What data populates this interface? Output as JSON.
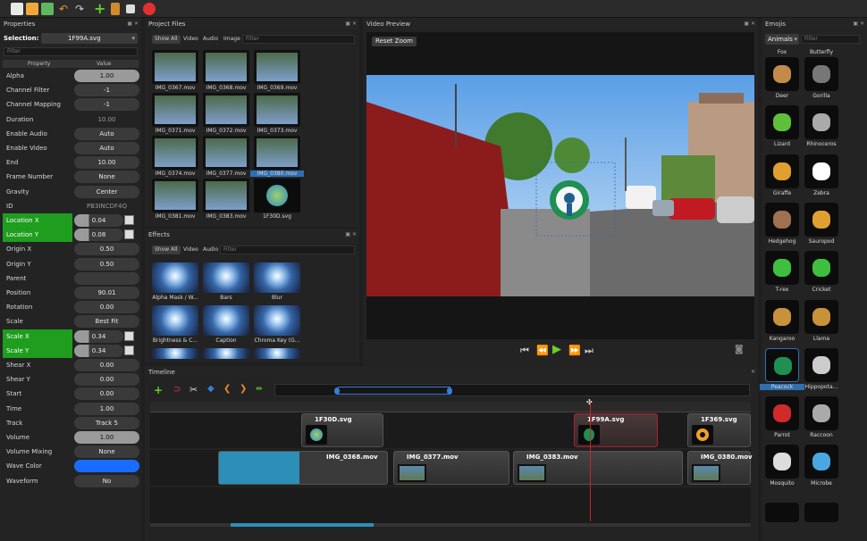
{
  "colors": {
    "accent_green": "#1e9d1e",
    "wave_color": "#1a6cff",
    "selection": "#2f6fb0",
    "playhead": "#d0202a"
  },
  "toolbar": {
    "icons": [
      "new-project-icon",
      "open-project-icon",
      "save-project-icon",
      "undo-icon",
      "redo-icon",
      "import-files-icon",
      "choose-profile-icon",
      "fullscreen-icon",
      "export-video-icon"
    ]
  },
  "properties": {
    "title": "Properties",
    "selection_label": "Selection:",
    "selection_value": "1F99A.svg",
    "filter_placeholder": "Filter",
    "col_property": "Property",
    "col_value": "Value",
    "rows": [
      {
        "name": "Alpha",
        "value": "1.00"
      },
      {
        "name": "Channel Filter",
        "value": "-1"
      },
      {
        "name": "Channel Mapping",
        "value": "-1"
      },
      {
        "name": "Duration",
        "value": "10.00"
      },
      {
        "name": "Enable Audio",
        "value": "Auto"
      },
      {
        "name": "Enable Video",
        "value": "Auto"
      },
      {
        "name": "End",
        "value": "10.00"
      },
      {
        "name": "Frame Number",
        "value": "None"
      },
      {
        "name": "Gravity",
        "value": "Center"
      },
      {
        "name": "ID",
        "value": "PB3INCDF4Q"
      },
      {
        "name": "Location X",
        "value": "0.04"
      },
      {
        "name": "Location Y",
        "value": "0.08"
      },
      {
        "name": "Origin X",
        "value": "0.50"
      },
      {
        "name": "Origin Y",
        "value": "0.50"
      },
      {
        "name": "Parent",
        "value": ""
      },
      {
        "name": "Position",
        "value": "90.01"
      },
      {
        "name": "Rotation",
        "value": "0.00"
      },
      {
        "name": "Scale",
        "value": "Best Fit"
      },
      {
        "name": "Scale X",
        "value": "0.34"
      },
      {
        "name": "Scale Y",
        "value": "0.34"
      },
      {
        "name": "Shear X",
        "value": "0.00"
      },
      {
        "name": "Shear Y",
        "value": "0.00"
      },
      {
        "name": "Start",
        "value": "0.00"
      },
      {
        "name": "Time",
        "value": "1.00"
      },
      {
        "name": "Track",
        "value": "Track 5"
      },
      {
        "name": "Volume",
        "value": "1.00"
      },
      {
        "name": "Volume Mixing",
        "value": "None"
      },
      {
        "name": "Wave Color",
        "value": ""
      },
      {
        "name": "Waveform",
        "value": "No"
      }
    ]
  },
  "project_files": {
    "title": "Project Files",
    "tabs": [
      "Show All",
      "Video",
      "Audio",
      "Image"
    ],
    "filter_placeholder": "Filter",
    "items": [
      "IMG_0367.mov",
      "IMG_0368.mov",
      "IMG_0369.mov",
      "IMG_0371.mov",
      "IMG_0372.mov",
      "IMG_0373.mov",
      "IMG_0374.mov",
      "IMG_0377.mov",
      "IMG_0380.mov",
      "IMG_0381.mov",
      "IMG_0383.mov",
      "1F30D.svg"
    ]
  },
  "effects": {
    "title": "Effects",
    "tabs": [
      "Show All",
      "Video",
      "Audio"
    ],
    "filter_placeholder": "Filter",
    "items": [
      "Alpha Mask / W...",
      "Bars",
      "Blur",
      "Brightness & C...",
      "Caption",
      "Chroma Key (G..."
    ]
  },
  "video_preview": {
    "title": "Video Preview",
    "reset_zoom": "Reset Zoom"
  },
  "emojis": {
    "title": "Emojis",
    "category": "Animals",
    "filter_placeholder": "Filter",
    "items": [
      "Fox",
      "Butterfly",
      "Deer",
      "Gorilla",
      "Lizard",
      "Rhinoceros",
      "Giraffe",
      "Zebra",
      "Hedgehog",
      "Sauropod",
      "T-rex",
      "Cricket",
      "Kangaroo",
      "Llama",
      "Peacock",
      "Hippopota...",
      "Parrot",
      "Raccoon",
      "Mosquito",
      "Microbe"
    ]
  },
  "timeline": {
    "title": "Timeline",
    "track1": [
      "1F30D.svg",
      "1F99A.svg",
      "1F369.svg"
    ],
    "track2": [
      "IMG_0368.mov",
      "IMG_0377.mov",
      "IMG_0383.mov",
      "IMG_0380.mov"
    ]
  }
}
